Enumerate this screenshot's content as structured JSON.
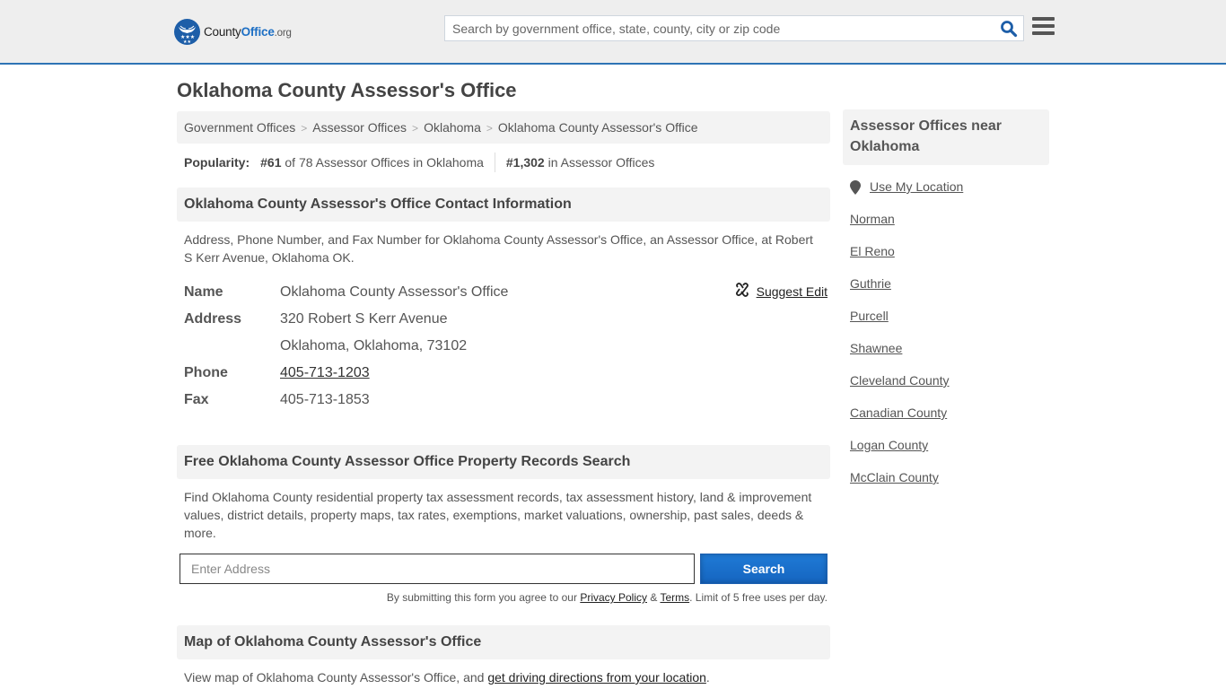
{
  "header": {
    "logo": {
      "brand_primary": "County",
      "brand_accent": "Office",
      "brand_suffix": ".org"
    },
    "search": {
      "placeholder": "Search by government office, state, county, city or zip code",
      "value": ""
    },
    "icons": {
      "search": "search-icon",
      "menu": "hamburger-menu-icon"
    },
    "accent_color": "#2e74b5"
  },
  "page": {
    "title": "Oklahoma County Assessor's Office"
  },
  "breadcrumb": [
    {
      "label": "Government Offices"
    },
    {
      "label": "Assessor Offices"
    },
    {
      "label": "Oklahoma"
    },
    {
      "label": "Oklahoma County Assessor's Office"
    }
  ],
  "popularity": {
    "label": "Popularity:",
    "state_rank": "#61",
    "state_rank_text": " of 78 Assessor Offices in Oklahoma",
    "national_rank": "#1,302",
    "national_rank_text": " in Assessor Offices"
  },
  "contact": {
    "heading": "Oklahoma County Assessor's Office Contact Information",
    "description": "Address, Phone Number, and Fax Number for Oklahoma County Assessor's Office, an Assessor Office, at Robert S Kerr Avenue, Oklahoma OK.",
    "suggest_edit": "Suggest Edit",
    "fields": {
      "name_label": "Name",
      "name_value": "Oklahoma County Assessor's Office",
      "address_label": "Address",
      "address_line1": "320 Robert S Kerr Avenue",
      "address_line2": "Oklahoma, Oklahoma, 73102",
      "phone_label": "Phone",
      "phone_value": "405-713-1203",
      "fax_label": "Fax",
      "fax_value": "405-713-1853"
    }
  },
  "records_search": {
    "heading": "Free Oklahoma County Assessor Office Property Records Search",
    "description": "Find Oklahoma County residential property tax assessment records, tax assessment history, land & improvement values, district details, property maps, tax rates, exemptions, market valuations, ownership, past sales, deeds & more.",
    "input_placeholder": "Enter Address",
    "input_value": "",
    "button_label": "Search",
    "disclaimer_prefix": "By submitting this form you agree to our ",
    "privacy_link": "Privacy Policy",
    "amp": " & ",
    "terms_link": "Terms",
    "disclaimer_suffix": ". Limit of 5 free uses per day.",
    "button_color": "#1a6fcf"
  },
  "map_section": {
    "heading": "Map of Oklahoma County Assessor's Office",
    "description_prefix": "View map of Oklahoma County Assessor's Office, and ",
    "directions_link": "get driving directions from your location",
    "description_suffix": "."
  },
  "sidebar": {
    "heading": "Assessor Offices near Oklahoma",
    "use_location": "Use My Location",
    "items": [
      {
        "label": "Norman"
      },
      {
        "label": "El Reno"
      },
      {
        "label": "Guthrie"
      },
      {
        "label": "Purcell"
      },
      {
        "label": "Shawnee"
      },
      {
        "label": "Cleveland County"
      },
      {
        "label": "Canadian County"
      },
      {
        "label": "Logan County"
      },
      {
        "label": "McClain County"
      }
    ]
  }
}
